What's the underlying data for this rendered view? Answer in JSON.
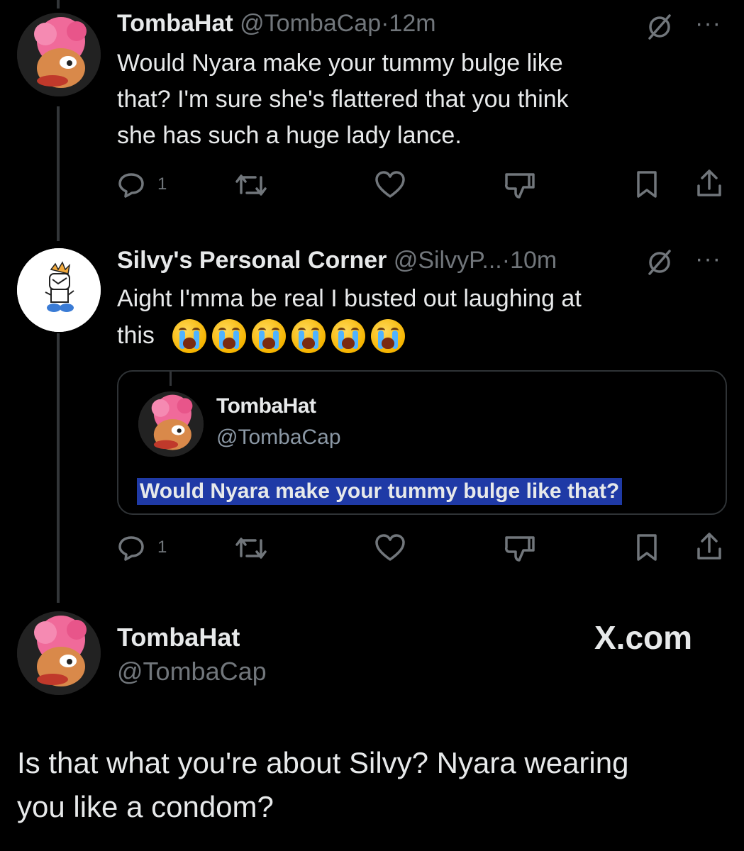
{
  "tweet1": {
    "name": "TombaHat",
    "handle": "@TombaCap",
    "time": "·12m",
    "text_lines": [
      "Would Nyara make your tummy bulge like",
      "that?  I'm sure she's flattered that you think",
      "she has such a huge lady lance."
    ],
    "reply_count": "1",
    "menu": "···"
  },
  "tweet2": {
    "name": "Silvy's Personal Corner",
    "handle": "@SilvyP...",
    "time": "·10m",
    "text_line1": "Aight I'mma be real I busted out laughing at",
    "text_line2": "this",
    "emoji_icon": "loudly-crying-face-icon",
    "reply_count": "1",
    "menu": "···",
    "quote": {
      "name": "TombaHat",
      "handle": "@TombaCap",
      "text": "Would Nyara make your tummy bulge like that?"
    }
  },
  "main": {
    "name": "TombaHat",
    "handle": "@TombaCap",
    "brand": "X.com",
    "text_lines": [
      "Is that what you're about Silvy?  Nyara wearing",
      "you like a condom?"
    ]
  },
  "colors": {
    "background": "#000000",
    "text": "#e7e9ea",
    "muted": "#71767b",
    "highlight": "#1f3aa6"
  }
}
